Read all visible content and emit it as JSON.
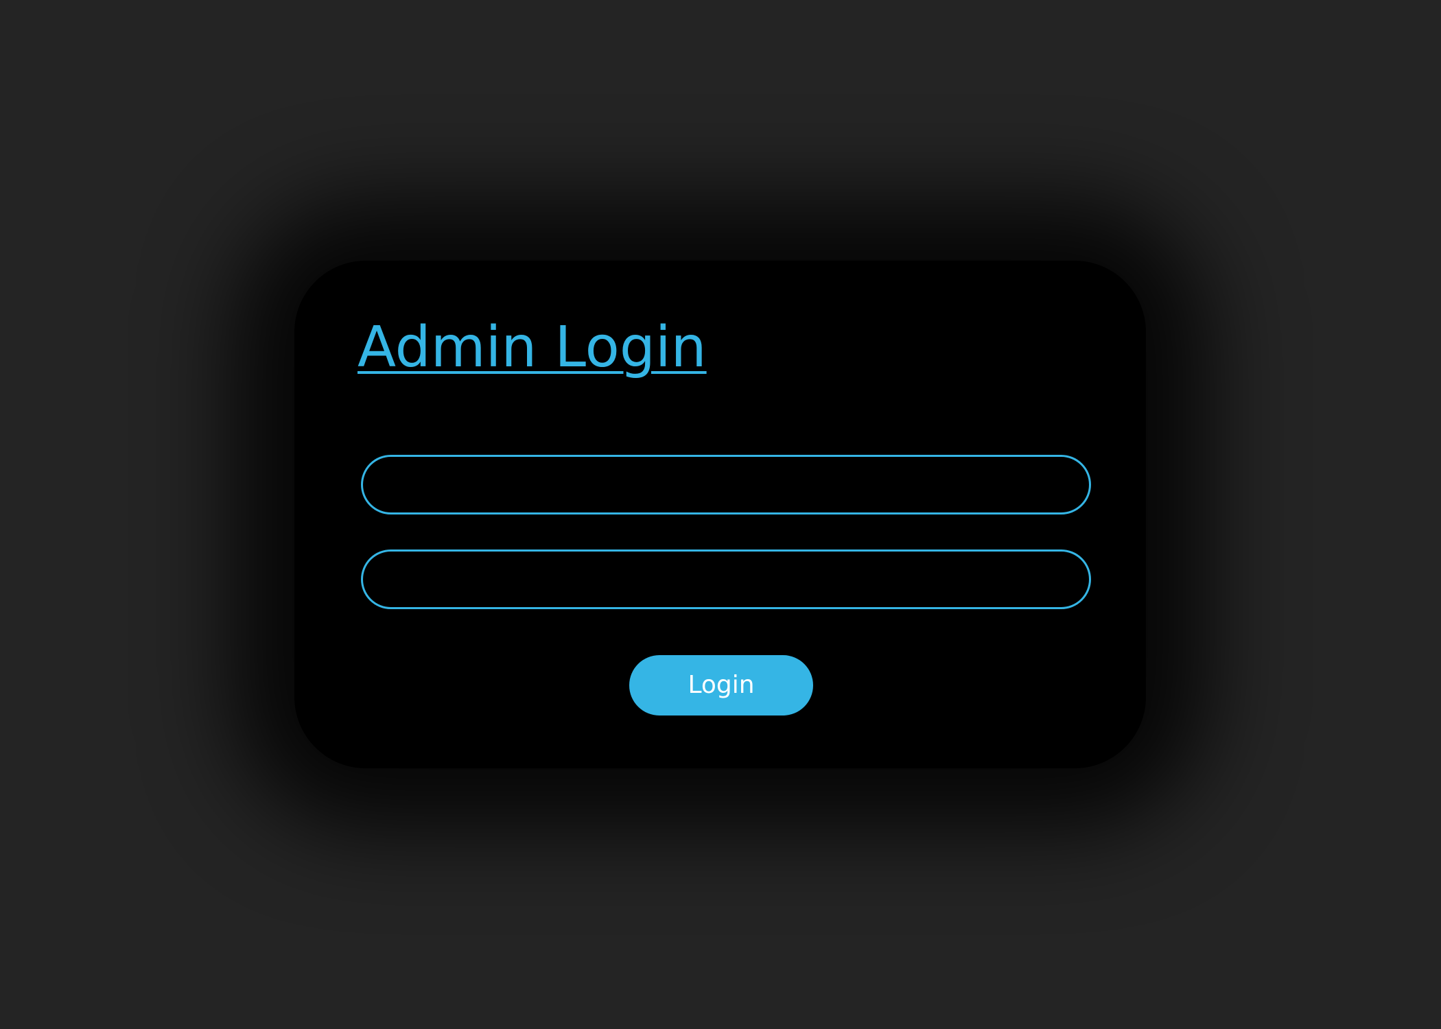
{
  "theme": {
    "accent": "#35b5e5",
    "card_background": "#000000",
    "page_background": "#242424",
    "button_text": "#ffffff"
  },
  "login": {
    "title": "Admin Login",
    "username_placeholder": "",
    "username_value": "",
    "password_placeholder": "",
    "password_value": "",
    "submit_label": "Login"
  }
}
